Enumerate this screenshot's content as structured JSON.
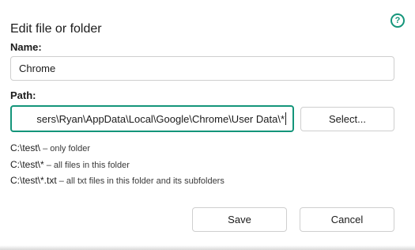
{
  "dialog": {
    "title": "Edit file or folder",
    "help_icon": "question-circle-icon",
    "help_symbol": "?"
  },
  "name_field": {
    "label": "Name:",
    "value": "Chrome"
  },
  "path_field": {
    "label": "Path:",
    "value": "sers\\Ryan\\AppData\\Local\\Google\\Chrome\\User Data\\*",
    "select_label": "Select..."
  },
  "hints": [
    {
      "pattern": "C:\\test\\",
      "description": " – only folder"
    },
    {
      "pattern": "C:\\test\\*",
      "description": " – all files in this folder"
    },
    {
      "pattern": "C:\\test\\*.txt",
      "description": " – all txt files in this folder and its subfolders"
    }
  ],
  "footer": {
    "save_label": "Save",
    "cancel_label": "Cancel"
  },
  "colors": {
    "accent": "#14957a",
    "border": "#cfcfcf"
  }
}
